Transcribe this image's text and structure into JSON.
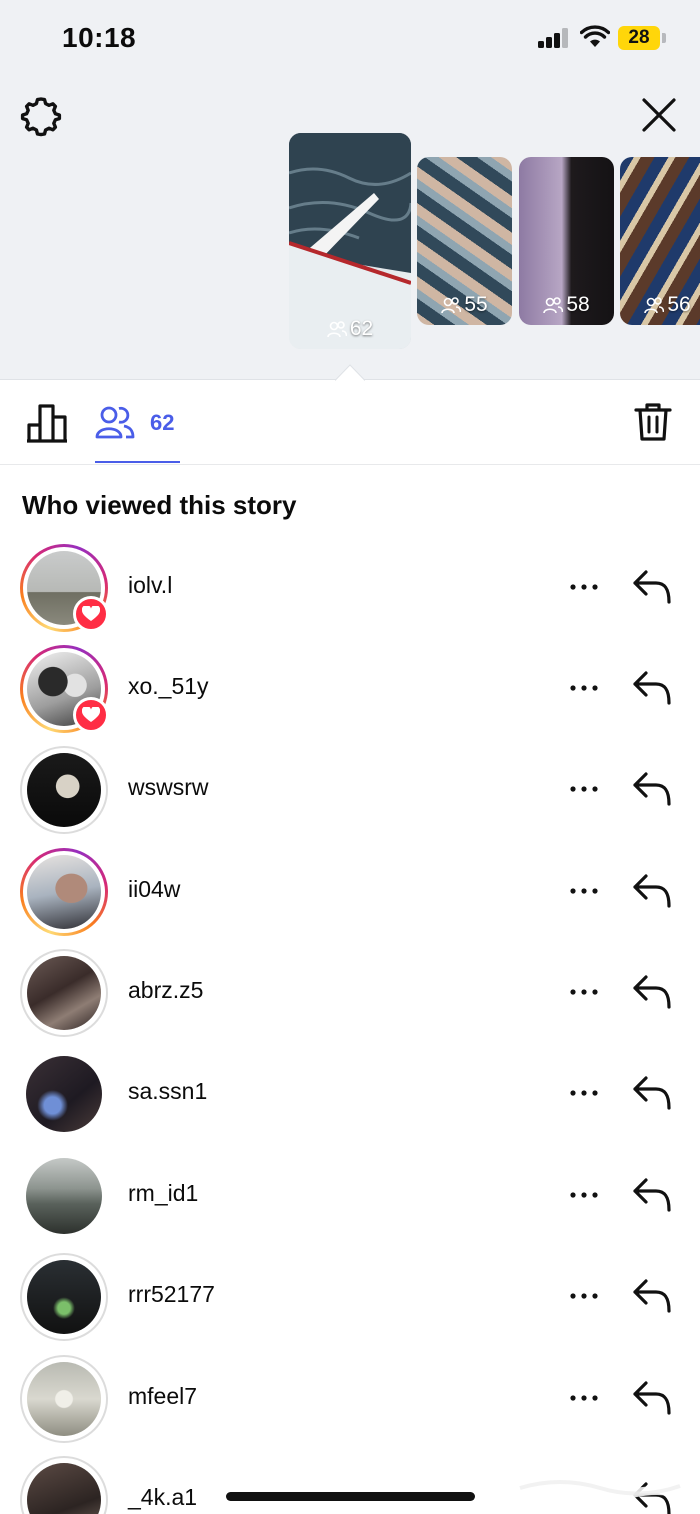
{
  "status_bar": {
    "time": "10:18",
    "battery": "28"
  },
  "thumbnails": [
    {
      "count": "62",
      "selected": true
    },
    {
      "count": "55"
    },
    {
      "count": "58"
    },
    {
      "count": "56"
    }
  ],
  "tabs": {
    "viewers_count": "62"
  },
  "section_title": "Who viewed this story",
  "viewers": [
    {
      "username": "iolv.l",
      "ring": "story",
      "liked": true
    },
    {
      "username": "xo._51y",
      "ring": "story",
      "liked": true
    },
    {
      "username": "wswsrw",
      "ring": "plain",
      "liked": false
    },
    {
      "username": "ii04w",
      "ring": "story",
      "liked": false
    },
    {
      "username": "abrz.z5",
      "ring": "plain",
      "liked": false
    },
    {
      "username": "sa.ssn1",
      "ring": "none",
      "liked": false
    },
    {
      "username": "rm_id1",
      "ring": "none",
      "liked": false
    },
    {
      "username": "rrr52177",
      "ring": "plain",
      "liked": false
    },
    {
      "username": "mfeel7",
      "ring": "plain",
      "liked": false
    },
    {
      "username": "_4k.a1",
      "ring": "plain",
      "liked": false
    }
  ],
  "colors": {
    "accent": "#4a5de8",
    "heart": "#ff2d44",
    "battery": "#ffd60a"
  },
  "icons": [
    "settings-gear-icon",
    "close-icon",
    "viewers-people-icon",
    "insights-bar-chart-icon",
    "trash-icon",
    "more-icon",
    "reply-icon",
    "heart-icon"
  ]
}
